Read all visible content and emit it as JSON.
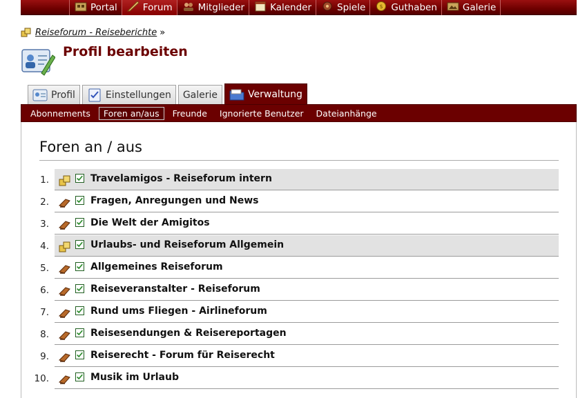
{
  "topnav": {
    "items": [
      {
        "label": "Portal",
        "icon": "portal-icon",
        "active": false
      },
      {
        "label": "Forum",
        "icon": "quill-icon",
        "active": true
      },
      {
        "label": "Mitglieder",
        "icon": "members-icon",
        "active": false
      },
      {
        "label": "Kalender",
        "icon": "calendar-icon",
        "active": false
      },
      {
        "label": "Spiele",
        "icon": "games-icon",
        "active": false
      },
      {
        "label": "Guthaben",
        "icon": "coin-icon",
        "active": false
      },
      {
        "label": "Galerie",
        "icon": "gallery-icon",
        "active": false
      }
    ]
  },
  "breadcrumb": {
    "link": "Reiseforum - Reiseberichte",
    "separator": "»"
  },
  "page": {
    "title": "Profil bearbeiten"
  },
  "tabs": [
    {
      "label": "Profil",
      "icon": "profile-card-icon",
      "active": false
    },
    {
      "label": "Einstellungen",
      "icon": "checklist-icon",
      "active": false
    },
    {
      "label": "Galerie",
      "icon": "",
      "active": false
    },
    {
      "label": "Verwaltung",
      "icon": "folder-icon",
      "active": true
    }
  ],
  "subnav": [
    {
      "label": "Abonnements",
      "active": false
    },
    {
      "label": "Foren an/aus",
      "active": true
    },
    {
      "label": "Freunde",
      "active": false
    },
    {
      "label": "Ignorierte Benutzer",
      "active": false
    },
    {
      "label": "Dateianhänge",
      "active": false
    }
  ],
  "content": {
    "heading": "Foren an / aus",
    "forums": [
      {
        "num": "1.",
        "name": "Travelamigos - Reiseforum intern",
        "icon": "category-icon",
        "highlight": true,
        "checked": true
      },
      {
        "num": "2.",
        "name": "Fragen, Anregungen und News",
        "icon": "forum-icon",
        "highlight": false,
        "checked": true
      },
      {
        "num": "3.",
        "name": "Die Welt der Amigitos",
        "icon": "forum-icon",
        "highlight": false,
        "checked": true
      },
      {
        "num": "4.",
        "name": "Urlaubs- und Reiseforum Allgemein",
        "icon": "category-icon",
        "highlight": true,
        "checked": true
      },
      {
        "num": "5.",
        "name": "Allgemeines Reiseforum",
        "icon": "forum-icon",
        "highlight": false,
        "checked": true
      },
      {
        "num": "6.",
        "name": "Reiseveranstalter - Reiseforum",
        "icon": "forum-icon",
        "highlight": false,
        "checked": true
      },
      {
        "num": "7.",
        "name": "Rund ums Fliegen - Airlineforum",
        "icon": "forum-icon",
        "highlight": false,
        "checked": true
      },
      {
        "num": "8.",
        "name": "Reisesendungen & Reisereportagen",
        "icon": "forum-icon",
        "highlight": false,
        "checked": true
      },
      {
        "num": "9.",
        "name": "Reiserecht - Forum für Reiserecht",
        "icon": "forum-icon",
        "highlight": false,
        "checked": true
      },
      {
        "num": "10.",
        "name": "Musik im Urlaub",
        "icon": "forum-icon",
        "highlight": false,
        "checked": true
      }
    ]
  },
  "colors": {
    "brand": "#6b0000",
    "check": "#2a8a2a"
  }
}
